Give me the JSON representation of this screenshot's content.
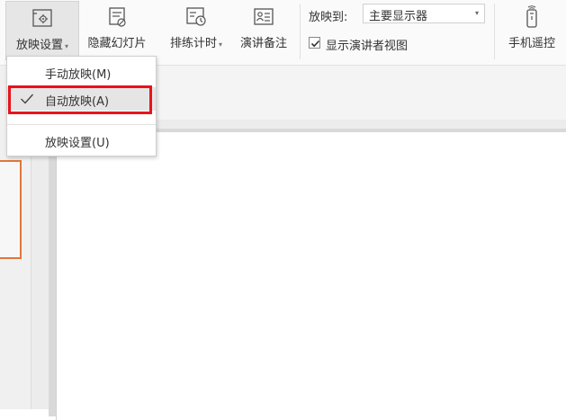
{
  "ribbon": {
    "settings_label": "放映设置",
    "hide_label": "隐藏幻灯片",
    "rehearse_label": "排练计时",
    "notes_label": "演讲备注",
    "show_to_label": "放映到:",
    "show_to_value": "主要显示器",
    "presenter_view_label": "显示演讲者视图",
    "presenter_view_checked": true,
    "remote_label": "手机遥控"
  },
  "menu": {
    "items": [
      {
        "label": "手动放映(M)",
        "checked": false
      },
      {
        "label": "自动放映(A)",
        "checked": true
      },
      {
        "label": "放映设置(U)",
        "checked": false
      }
    ]
  },
  "colors": {
    "highlight_border": "#e8131c",
    "thumbnail_border": "#e0783a"
  }
}
